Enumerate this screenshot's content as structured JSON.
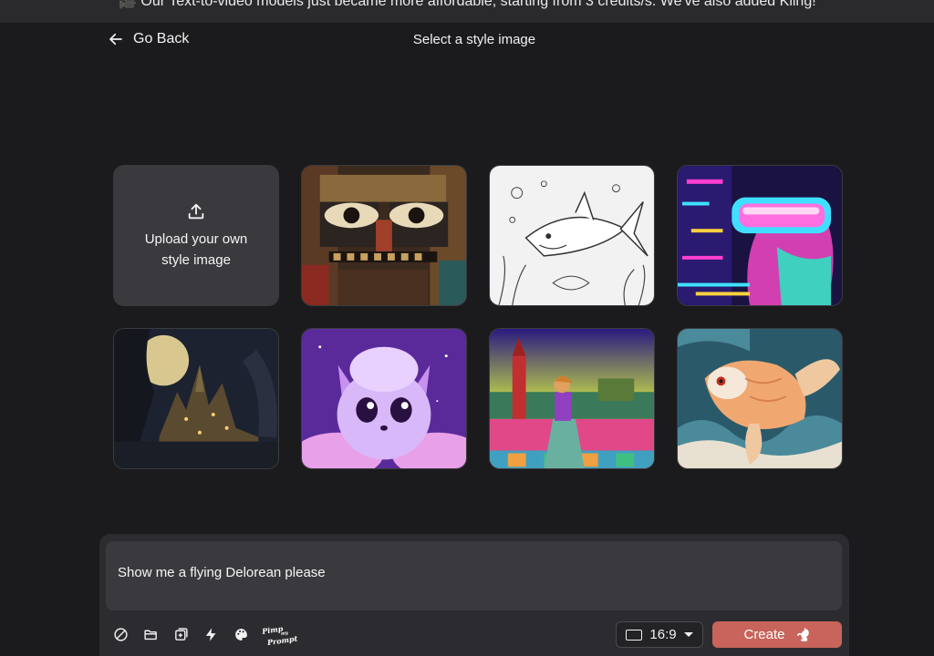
{
  "banner": {
    "text": "🎥 Our Text-to-video models just became more affordable, starting from 3 credits/s. We've also added Kling!"
  },
  "header": {
    "back_label": "Go Back",
    "title": "Select a style image"
  },
  "upload": {
    "label": "Upload your own style image",
    "icon": "upload-icon"
  },
  "styles": [
    {
      "name": "cubist-mosaic-face"
    },
    {
      "name": "underwater-shark-coloring-page"
    },
    {
      "name": "neon-cyberpunk-goggles-portrait"
    },
    {
      "name": "moonlit-fantasy-castle"
    },
    {
      "name": "fluffy-purple-creature"
    },
    {
      "name": "retro-woman-kremlin-view"
    },
    {
      "name": "paper-art-koi-fish"
    }
  ],
  "composer": {
    "prompt": "Show me a flying Delorean please",
    "tools": [
      "no-entry-icon",
      "folder-icon",
      "add-image-icon",
      "lightning-icon",
      "palette-icon"
    ],
    "pimp_label_1": "Pimp",
    "pimp_label_2": "my",
    "pimp_label_3": "Prompt",
    "aspect_ratio": "16:9",
    "create_label": "Create"
  },
  "colors": {
    "background": "#1b1b1d",
    "panel": "#2c2c30",
    "tile": "#3a393e",
    "accent": "#c8645b"
  }
}
